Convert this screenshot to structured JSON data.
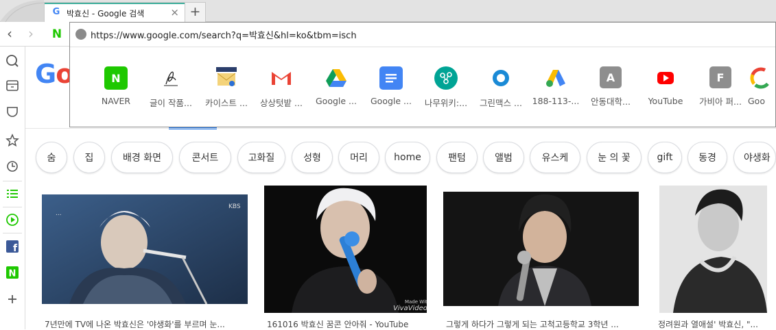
{
  "browser": {
    "tab": {
      "title": "박효신 - Google 검색",
      "favicon": "G",
      "close_glyph": "×"
    },
    "new_tab_glyph": "+",
    "nav": {
      "back": "‹",
      "forward": "›"
    },
    "naver_logo": "N",
    "address": "https://www.google.com/search?q=박효신&hl=ko&tbm=isch",
    "speed_dial": [
      {
        "label": "NAVER",
        "icon": "naver-icon",
        "glyph": "N",
        "bg": "#1ec800"
      },
      {
        "label": "글이 작품...",
        "icon": "signature-icon",
        "glyph": "",
        "bg": "#ffffff"
      },
      {
        "label": "카이스트 ...",
        "icon": "kaist-mail-icon",
        "glyph": "",
        "bg": "#ffffff"
      },
      {
        "label": "상상텃밭 ...",
        "icon": "gmail-icon",
        "glyph": "",
        "bg": "#ffffff"
      },
      {
        "label": "Google ...",
        "icon": "google-drive-icon",
        "glyph": "",
        "bg": "#ffffff"
      },
      {
        "label": "Google ...",
        "icon": "google-docs-icon",
        "glyph": "",
        "bg": "#4285f4"
      },
      {
        "label": "나무위키:...",
        "icon": "namuwiki-icon",
        "glyph": "",
        "bg": "#00a495"
      },
      {
        "label": "그린맥스 ...",
        "icon": "greenmax-icon",
        "glyph": "",
        "bg": "#ffffff"
      },
      {
        "label": "188-113-...",
        "icon": "google-ads-icon",
        "glyph": "",
        "bg": "#ffffff"
      },
      {
        "label": "안동대학...",
        "icon": "letter-a-icon",
        "glyph": "A",
        "bg": "#8e8e8e"
      },
      {
        "label": "YouTube",
        "icon": "youtube-icon",
        "glyph": "",
        "bg": "#ffffff"
      },
      {
        "label": "가비아 퍼...",
        "icon": "letter-f-icon",
        "glyph": "F",
        "bg": "#8e8e8e"
      },
      {
        "label": "Goo",
        "icon": "google-icon",
        "glyph": "G",
        "bg": "#ffffff"
      }
    ]
  },
  "google": {
    "logo_blue": "G",
    "logo_red": "o",
    "chips": [
      "숨",
      "집",
      "배경 화면",
      "콘서트",
      "고화질",
      "성형",
      "머리",
      "home",
      "팬텀",
      "앨범",
      "유스케",
      "눈 의 꽃",
      "gift",
      "동경",
      "야생화"
    ],
    "results": [
      {
        "caption": "7년만에 TV에 나온 박효신은 '야생화'를 부르며 눈...",
        "watermark": "KBS"
      },
      {
        "caption": "161016 박효신 꿈콘 안아줘 - YouTube",
        "watermark": "Made With VivaVideo"
      },
      {
        "caption": "그렇게 하다가 그렇게 되는 고척고등학교 3학년 ...",
        "watermark": ""
      },
      {
        "caption": "정려원과 열애설' 박효신, \"...",
        "watermark": ""
      }
    ]
  },
  "colors": {
    "accent": "#1a73e8",
    "naver_green": "#1ec800"
  }
}
